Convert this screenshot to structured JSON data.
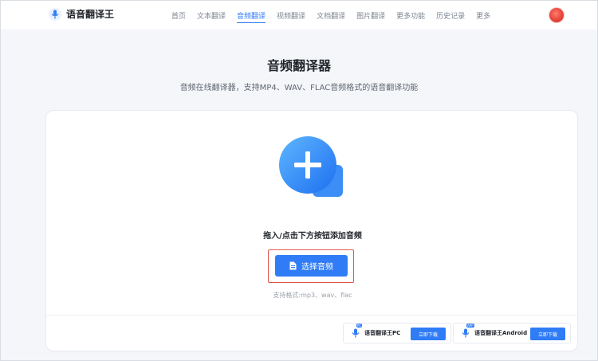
{
  "brand": {
    "name": "语音翻译王"
  },
  "nav": {
    "items": [
      {
        "label": "首页"
      },
      {
        "label": "文本翻译"
      },
      {
        "label": "音频翻译"
      },
      {
        "label": "视频翻译"
      },
      {
        "label": "文档翻译"
      },
      {
        "label": "图片翻译"
      },
      {
        "label": "更多功能"
      },
      {
        "label": "历史记录"
      },
      {
        "label": "更多"
      }
    ],
    "active": "音频翻译"
  },
  "page": {
    "title": "音频翻译器",
    "subtitle": "音频在线翻译器，支持MP4、WAV、FLAC音频格式的语音翻译功能"
  },
  "upload": {
    "hint": "拖入/点击下方按钮添加音频",
    "button_label": "选择音频",
    "formats": "支持格式:mp3、wav、flac"
  },
  "downloads": {
    "pc": {
      "name": "语音翻译王PC",
      "badge": "PC",
      "button": "立即下载"
    },
    "android": {
      "name": "语音翻译王Android",
      "badge": "APP",
      "button": "立即下载"
    }
  },
  "colors": {
    "accent": "#2f7cf6",
    "highlight_border": "#e2554d",
    "background": "#f4f6fa"
  }
}
